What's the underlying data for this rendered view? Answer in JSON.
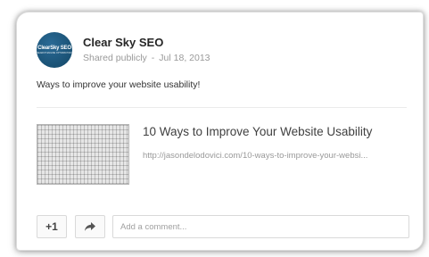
{
  "post": {
    "avatar": {
      "logo_main": "ClearSky SEO",
      "logo_sub": "SEARCH ENGINE OPTIMIZATION"
    },
    "author": "Clear Sky SEO",
    "visibility": "Shared publicly",
    "separator": "-",
    "date": "Jul 18, 2013",
    "text": "Ways to improve your website usability!"
  },
  "link": {
    "title": "10 Ways to Improve Your Website Usability",
    "url": "http://jasondelodovici.com/10-ways-to-improve-your-websi..."
  },
  "actions": {
    "plus_one": "+1",
    "share_icon": "share-arrow-icon",
    "comment_placeholder": "Add a comment..."
  }
}
